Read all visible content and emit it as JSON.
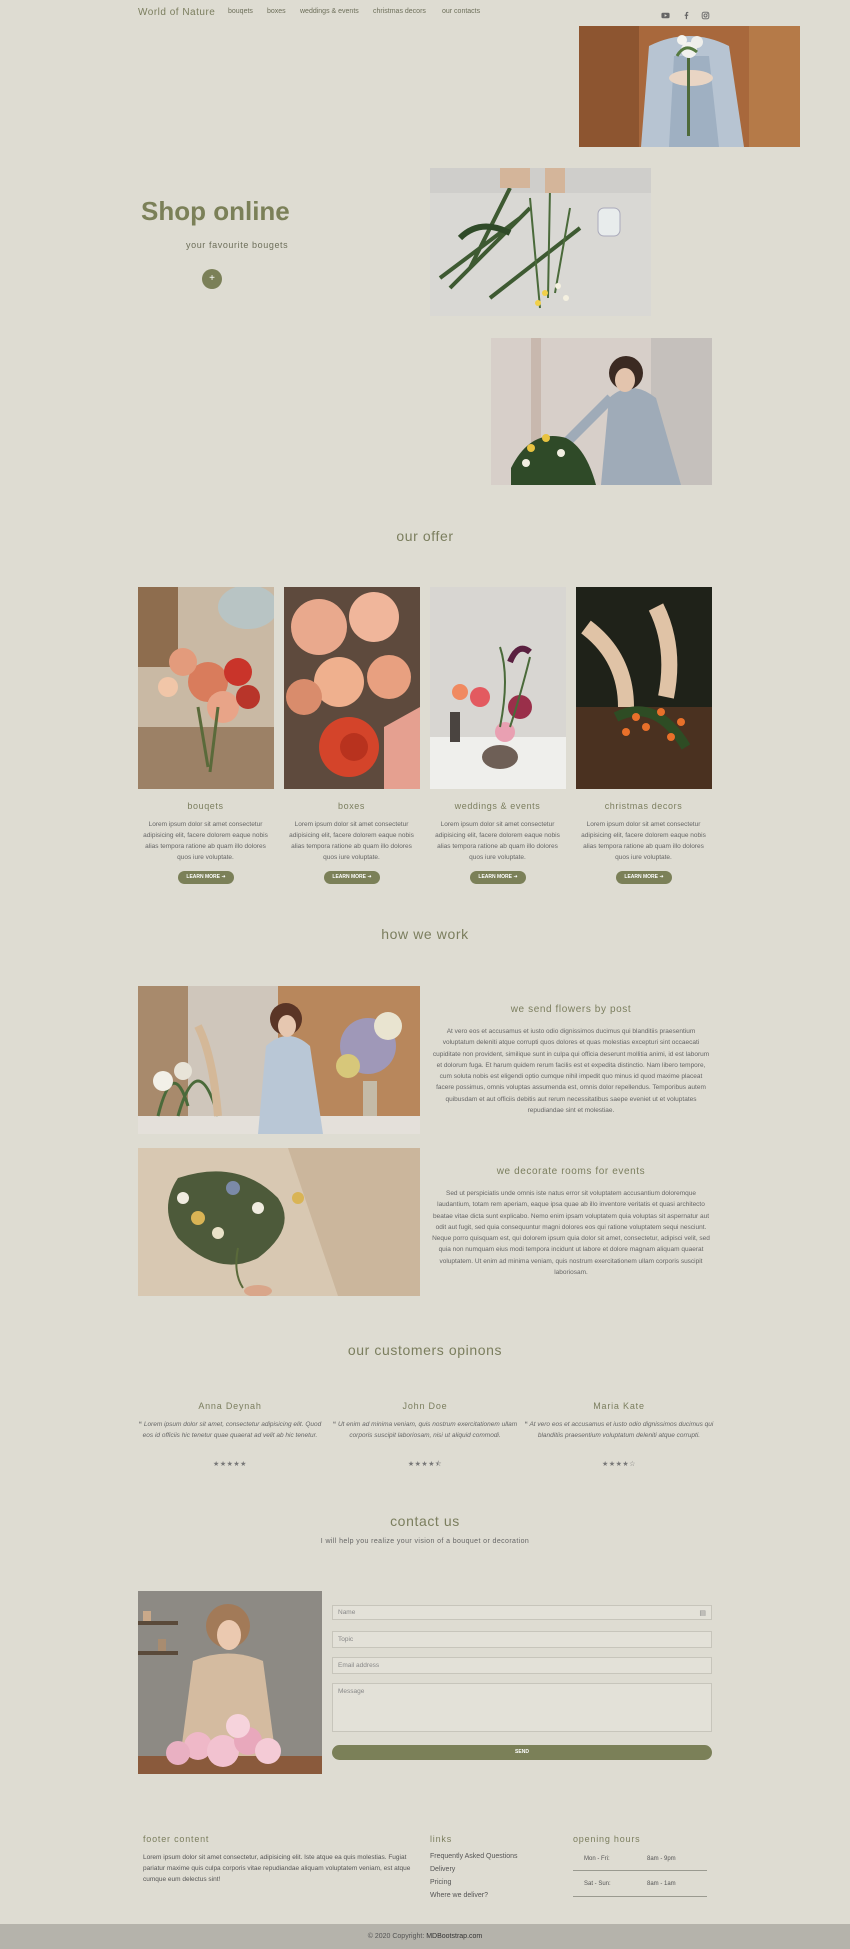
{
  "nav": {
    "brand": "World of Nature",
    "links": [
      "bouqets",
      "boxes",
      "weddings & events",
      "christmas decors",
      "our contacts"
    ],
    "social": [
      "youtube-icon",
      "facebook-icon",
      "instagram-icon"
    ]
  },
  "hero": {
    "title": "Shop online",
    "subtitle": "your favourite bougets",
    "button_icon": "+"
  },
  "offer": {
    "title": "our offer",
    "cards": [
      {
        "title": "bouqets",
        "desc": "Lorem ipsum dolor sit amet consectetur adipisicing elit, facere dolorem eaque nobis alias tempora ratione ab quam illo dolores quos iure voluptate.",
        "button": "LEARN MORE"
      },
      {
        "title": "boxes",
        "desc": "Lorem ipsum dolor sit amet consectetur adipisicing elit, facere dolorem eaque nobis alias tempora ratione ab quam illo dolores quos iure voluptate.",
        "button": "LEARN MORE"
      },
      {
        "title": "weddings & events",
        "desc": "Lorem ipsum dolor sit amet consectetur adipisicing elit, facere dolorem eaque nobis alias tempora ratione ab quam illo dolores quos iure voluptate.",
        "button": "LEARN MORE"
      },
      {
        "title": "christmas decors",
        "desc": "Lorem ipsum dolor sit amet consectetur adipisicing elit, facere dolorem eaque nobis alias tempora ratione ab quam illo dolores quos iure voluptate.",
        "button": "LEARN MORE"
      }
    ]
  },
  "how": {
    "title": "how we work",
    "items": [
      {
        "title": "we send flowers by post",
        "text": "At vero eos et accusamus et iusto odio dignissimos ducimus qui blanditiis praesentium voluptatum deleniti atque corrupti quos dolores et quas molestias excepturi sint occaecati cupiditate non provident, similique sunt in culpa qui officia deserunt mollitia animi, id est laborum et dolorum fuga. Et harum quidem rerum facilis est et expedita distinctio. Nam libero tempore, cum soluta nobis est eligendi optio cumque nihil impedit quo minus id quod maxime placeat facere possimus, omnis voluptas assumenda est, omnis dolor repellendus. Temporibus autem quibusdam et aut officiis debitis aut rerum necessitatibus saepe eveniet ut et voluptates repudiandae sint et molestiae."
      },
      {
        "title": "we decorate rooms for events",
        "text": "Sed ut perspiciatis unde omnis iste natus error sit voluptatem accusantium doloremque laudantium, totam rem aperiam, eaque ipsa quae ab illo inventore veritatis et quasi architecto beatae vitae dicta sunt explicabo. Nemo enim ipsam voluptatem quia voluptas sit aspernatur aut odit aut fugit, sed quia consequuntur magni dolores eos qui ratione voluptatem sequi nesciunt. Neque porro quisquam est, qui dolorem ipsum quia dolor sit amet, consectetur, adipisci velit, sed quia non numquam eius modi tempora incidunt ut labore et dolore magnam aliquam quaerat voluptatem. Ut enim ad minima veniam, quis nostrum exercitationem ullam corporis suscipit laboriosam."
      }
    ]
  },
  "reviews": {
    "title": "our customers opinons",
    "items": [
      {
        "name": "Anna Deynah",
        "quote_icon": "“",
        "text": "Lorem ipsum dolor sit amet, consectetur adipisicing elit. Quod eos id officiis hic tenetur quae quaerat ad velit ab hic tenetur.",
        "rating": 5,
        "stars": "★★★★★"
      },
      {
        "name": "John Doe",
        "quote_icon": "“",
        "text": "Ut enim ad minima veniam, quis nostrum exercitationem ullam corporis suscipit laboriosam, nisi ut aliquid commodi.",
        "rating": 4.5,
        "stars": "★★★★⯪"
      },
      {
        "name": "Maria Kate",
        "quote_icon": "“",
        "text": "At vero eos et accusamus et iusto odio dignissimos ducimus qui blanditiis praesentium voluptatum deleniti atque corrupti.",
        "rating": 4,
        "stars": "★★★★☆"
      }
    ]
  },
  "contact": {
    "title": "contact us",
    "subtitle": "I will help you realize your vision of a bouquet or decoration",
    "name_placeholder": "Name",
    "topic_placeholder": "Topic",
    "email_placeholder": "Email address",
    "message_placeholder": "Message",
    "send": "SEND"
  },
  "footer": {
    "content_title": "footer content",
    "content_text": "Lorem ipsum dolor sit amet consectetur, adipisicing elit. Iste atque ea quis molestias. Fugiat pariatur maxime quis culpa corporis vitae repudiandae aliquam voluptatem veniam, est atque cumque eum delectus sint!",
    "links_title": "links",
    "links": [
      "Frequently Asked Questions",
      "Delivery",
      "Pricing",
      "Where we deliver?"
    ],
    "hours_title": "opening hours",
    "hours": [
      {
        "days": "Mon - Fri:",
        "time": "8am - 9pm"
      },
      {
        "days": "Sat - Sun:",
        "time": "8am - 1am"
      }
    ],
    "copyright_prefix": "© 2020 Copyright:",
    "copyright_link": "MDBootstrap.com"
  },
  "colors": {
    "background": "#dedcd2",
    "accent": "#7b8058",
    "heading": "#7b7e5e"
  }
}
